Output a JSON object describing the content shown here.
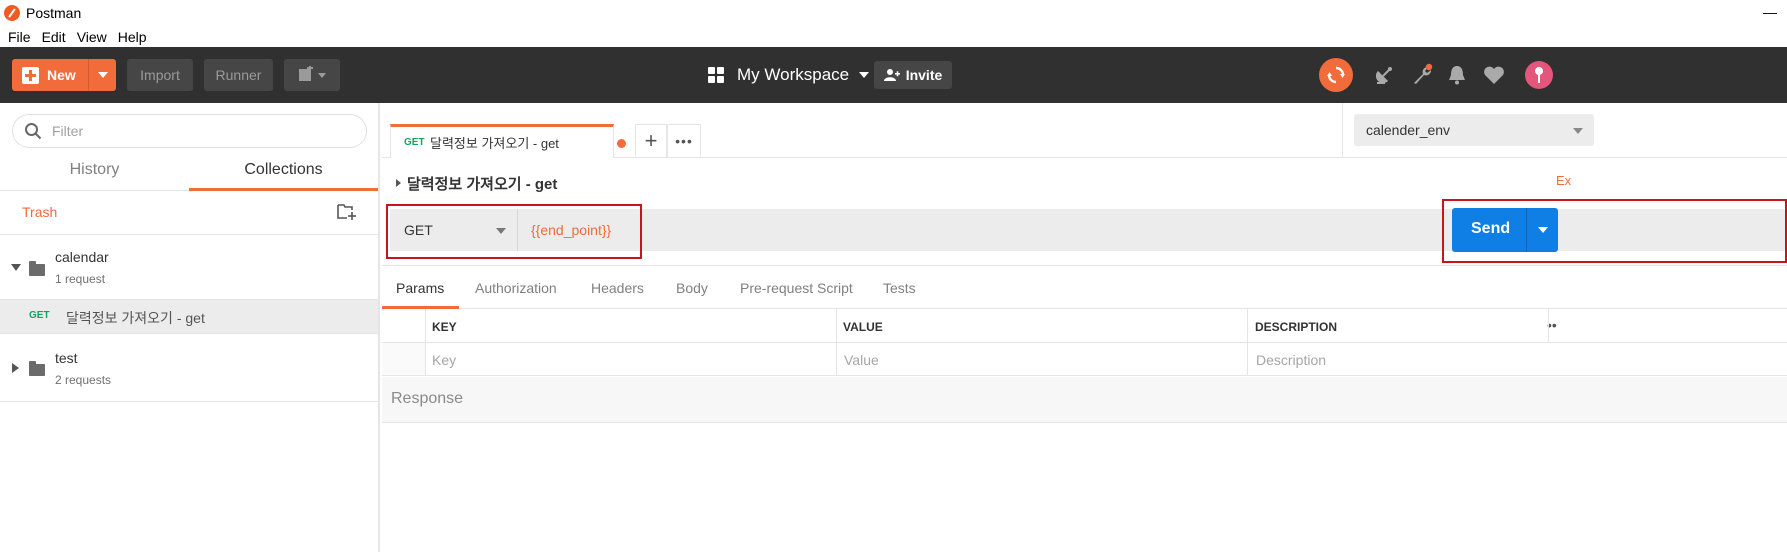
{
  "window": {
    "title": "Postman",
    "minimize": "—"
  },
  "menu": [
    "File",
    "Edit",
    "View",
    "Help"
  ],
  "header": {
    "new_label": "New",
    "import_label": "Import",
    "runner_label": "Runner",
    "workspace_label": "My Workspace",
    "invite_label": "Invite",
    "accent": "#f26b3a"
  },
  "sidebar": {
    "filter_placeholder": "Filter",
    "tabs": [
      "History",
      "Collections"
    ],
    "active_tab": "Collections",
    "trash_label": "Trash",
    "collections": [
      {
        "name": "calendar",
        "count": "1 request",
        "expanded": true
      },
      {
        "name": "test",
        "count": "2 requests",
        "expanded": false
      }
    ],
    "request": {
      "method": "GET",
      "name": "달력정보 가져오기 - get"
    }
  },
  "main": {
    "tab": {
      "method": "GET",
      "name": "달력정보 가져오기 - get"
    },
    "environment": "calender_env",
    "request_title": "달력정보 가져오기 - get",
    "examples_label": "Ex",
    "method": "GET",
    "url": "{{end_point}}",
    "send_label": "Send",
    "send_color": "#0f7fe5",
    "sub_tabs": [
      "Params",
      "Authorization",
      "Headers",
      "Body",
      "Pre-request Script",
      "Tests"
    ],
    "active_sub_tab": "Params",
    "params_columns": [
      "KEY",
      "VALUE",
      "DESCRIPTION"
    ],
    "params_placeholders": [
      "Key",
      "Value",
      "Description"
    ],
    "response_label": "Response"
  }
}
